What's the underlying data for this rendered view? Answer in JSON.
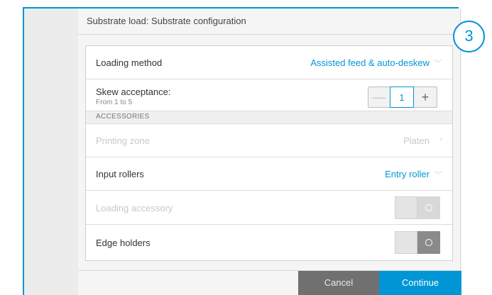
{
  "dialog": {
    "title": "Substrate load: Substrate configuration"
  },
  "loading_method": {
    "label": "Loading method",
    "value": "Assisted feed & auto-deskew"
  },
  "skew": {
    "label": "Skew acceptance:",
    "range": "From 1 to 5",
    "value": "1",
    "minus": "—",
    "plus": "+"
  },
  "section": {
    "label": "ACCESSORIES"
  },
  "printing_zone": {
    "label": "Printing zone",
    "value": "Platen"
  },
  "input_rollers": {
    "label": "Input rollers",
    "value": "Entry roller"
  },
  "loading_accessory": {
    "label": "Loading accessory"
  },
  "edge_holders": {
    "label": "Edge holders"
  },
  "footer": {
    "cancel": "Cancel",
    "continue": "Continue"
  },
  "step_badge": "3",
  "icons": {
    "chevron_down": "chevron-down-icon",
    "chevron_right": "chevron-right-icon"
  },
  "colors": {
    "accent": "#0096d6",
    "cancel_bg": "#707070"
  }
}
